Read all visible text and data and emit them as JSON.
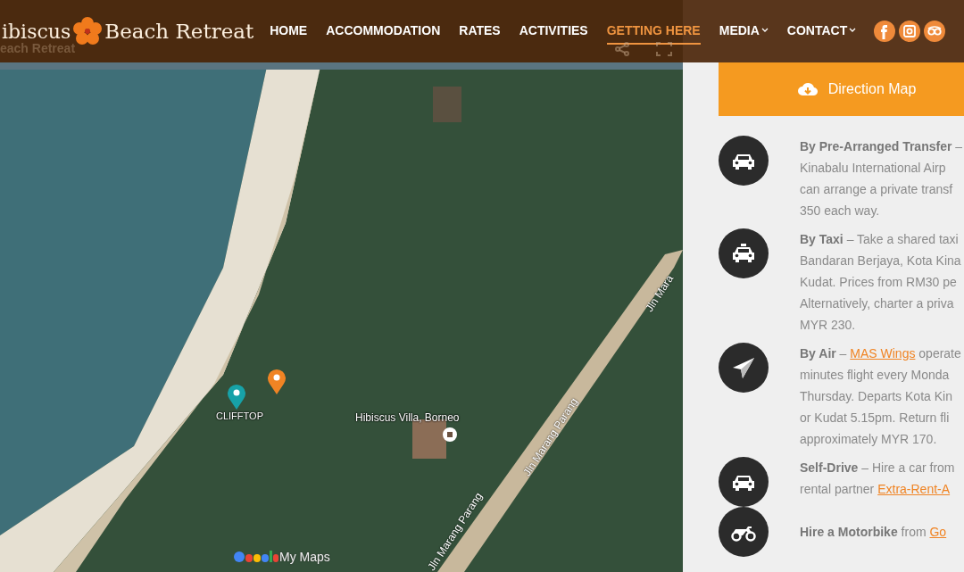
{
  "header": {
    "logo_left": "ibiscus",
    "logo_right": "Beach Retreat",
    "nav": [
      {
        "label": "HOME",
        "selected": false,
        "dropdown": false
      },
      {
        "label": "ACCOMMODATION",
        "selected": false,
        "dropdown": false
      },
      {
        "label": "RATES",
        "selected": false,
        "dropdown": false
      },
      {
        "label": "ACTIVITIES",
        "selected": false,
        "dropdown": false
      },
      {
        "label": "GETTING HERE",
        "selected": true,
        "dropdown": false
      },
      {
        "label": "MEDIA",
        "selected": false,
        "dropdown": true
      },
      {
        "label": "CONTACT",
        "selected": false,
        "dropdown": true
      }
    ],
    "social": [
      {
        "kind": "facebook"
      },
      {
        "kind": "instagram"
      },
      {
        "kind": "tripadvisor"
      }
    ]
  },
  "map": {
    "title": "each Retreat",
    "markers": [
      {
        "kind": "pin",
        "color": "#17a2a8",
        "label": "CLIFFTOP"
      },
      {
        "kind": "pin",
        "color": "#f08424"
      },
      {
        "kind": "place",
        "label": "Hibiscus Villa, Borneo"
      }
    ],
    "roads": [
      "Jln Mara",
      "Jln Marang Parang",
      "Jln Marang Parang"
    ],
    "attribution": "My Maps"
  },
  "panel": {
    "button": "Direction Map",
    "items": [
      {
        "kind": "car",
        "lines": [
          [
            {
              "kind": "text",
              "text": "**By Pre-Arranged Transfer** –"
            }
          ],
          [
            {
              "kind": "text",
              "text": "Kinabalu International Airp"
            }
          ],
          [
            {
              "kind": "text",
              "text": "can arrange a private transf"
            }
          ],
          [
            {
              "kind": "text",
              "text": "350 each way."
            }
          ]
        ]
      },
      {
        "kind": "taxi",
        "lines": [
          [
            {
              "kind": "text",
              "text": "**By Taxi** – Take a shared taxi"
            }
          ],
          [
            {
              "kind": "text",
              "text": "Bandaran Berjaya, Kota Kina"
            }
          ],
          [
            {
              "kind": "text",
              "text": "Kudat. Prices from RM30 pe"
            }
          ],
          [
            {
              "kind": "text",
              "text": "Alternatively, charter a priva"
            }
          ],
          [
            {
              "kind": "text",
              "text": "MYR 230."
            }
          ]
        ]
      },
      {
        "kind": "plane",
        "lines": [
          [
            {
              "kind": "text",
              "text": "**By Air** – "
            },
            {
              "kind": "link",
              "text": "MAS Wings"
            },
            {
              "kind": "text",
              "text": " operate"
            }
          ],
          [
            {
              "kind": "text",
              "text": "minutes flight every Monda"
            }
          ],
          [
            {
              "kind": "text",
              "text": "Thursday. Departs Kota Kin"
            }
          ],
          [
            {
              "kind": "text",
              "text": "or Kudat 5.15pm. Return fli"
            }
          ],
          [
            {
              "kind": "text",
              "text": "approximately MYR 170."
            }
          ]
        ]
      },
      {
        "kind": "car",
        "lines": [
          [
            {
              "kind": "text",
              "text": "**Self-Drive** – Hire a car from"
            }
          ],
          [
            {
              "kind": "text",
              "text": "rental partner "
            },
            {
              "kind": "link",
              "text": "Extra-Rent-A"
            }
          ]
        ]
      },
      {
        "kind": "motorbike",
        "lines": [
          [
            {
              "kind": "text",
              "text": "**Hire a Motorbike** from "
            },
            {
              "kind": "link",
              "text": "Go"
            }
          ]
        ]
      }
    ]
  }
}
